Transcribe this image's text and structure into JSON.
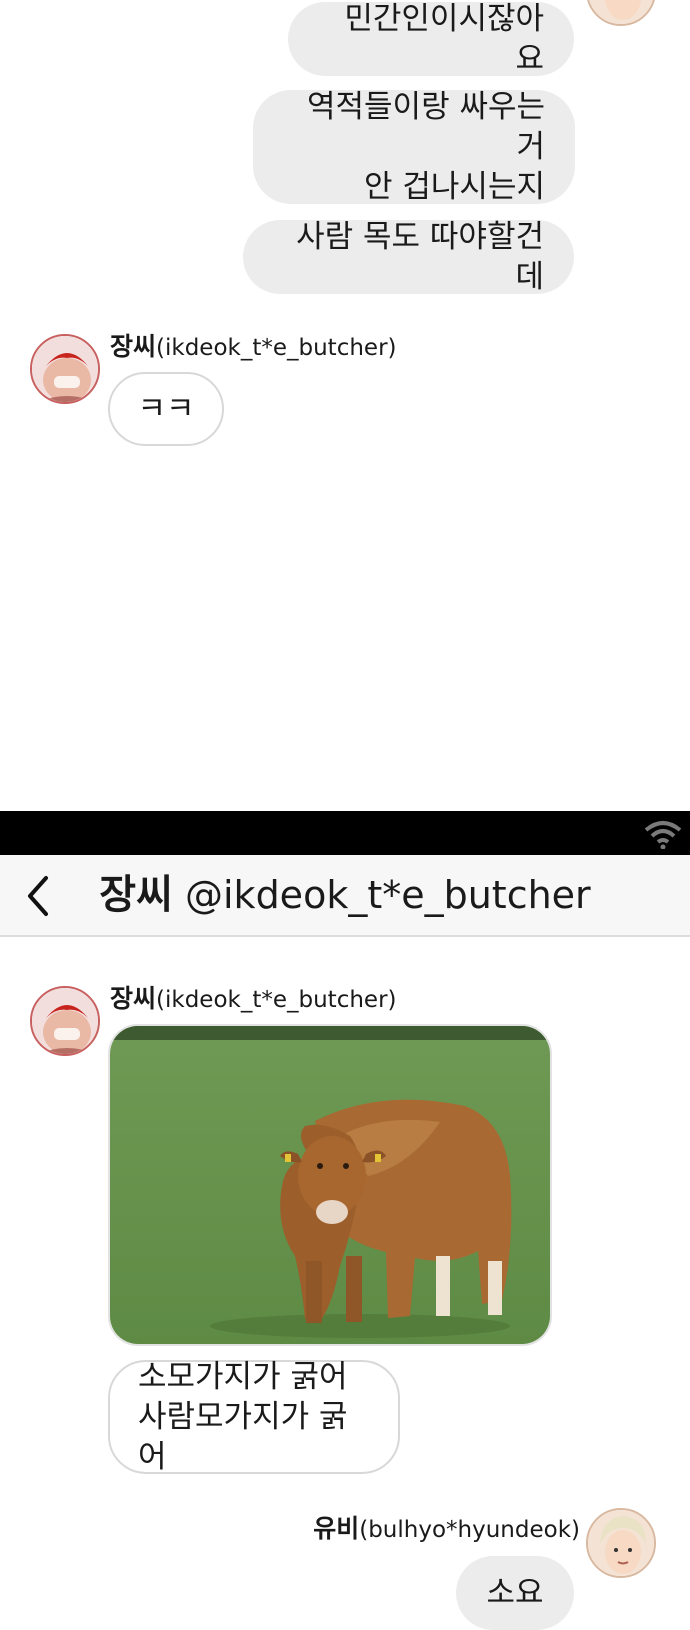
{
  "upper": {
    "outgoing": [
      {
        "text": "민간인이시잖아요"
      },
      {
        "text": "역적들이랑 싸우는거\n안 겁나시는지"
      },
      {
        "text": "사람 목도 따야할건데"
      }
    ],
    "incoming": {
      "sender_name": "장씨",
      "sender_handle": "(ikdeok_t*e_butcher)",
      "text": "ㅋㅋ"
    }
  },
  "header": {
    "back_icon": "chevron-left-icon",
    "title_name": "장씨",
    "title_handle": "@ikdeok_t*e_butcher",
    "wifi_icon": "wifi-icon"
  },
  "lower": {
    "incoming": {
      "sender_name": "장씨",
      "sender_handle": "(ikdeok_t*e_butcher)",
      "image_subject": "bull-photo",
      "text": "소모가지가 굵어\n사람모가지가 굵어"
    },
    "outgoing": {
      "sender_name": "유비",
      "sender_handle": "(bulhyo*hyundeok)",
      "text": "소요"
    }
  },
  "colors": {
    "outgoing_bubble": "#ececec",
    "incoming_border": "#d8d8d8",
    "status_bar": "#000000",
    "header_bg": "#f7f7f7"
  }
}
